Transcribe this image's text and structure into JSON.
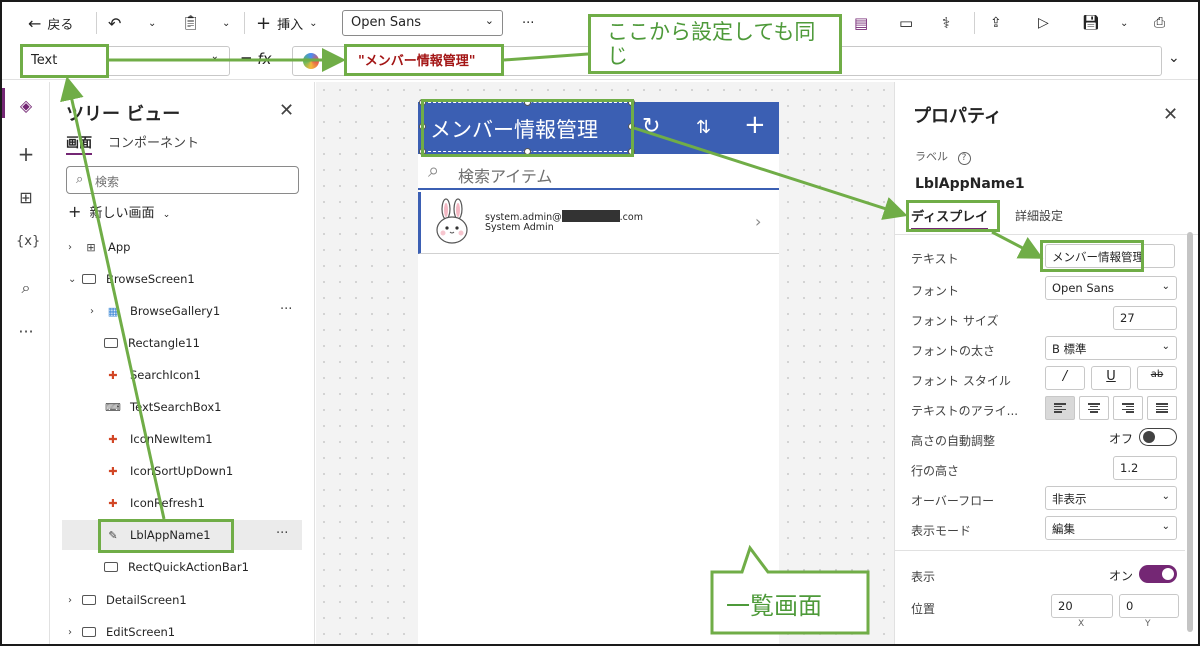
{
  "toolbar": {
    "back_label": "戻る",
    "insert_label": "挿入",
    "font_value": "Open Sans",
    "more": "···"
  },
  "formula": {
    "property": "Text",
    "fx": "= fx",
    "value": "\"メンバー情報管理\""
  },
  "tree": {
    "title": "ツリー ビュー",
    "tabs": [
      "画面",
      "コンポーネント"
    ],
    "search_placeholder": "検索",
    "new_screen": "新しい画面",
    "nodes": [
      {
        "label": "App"
      },
      {
        "label": "BrowseScreen1"
      },
      {
        "label": "BrowseGallery1"
      },
      {
        "label": "Rectangle11"
      },
      {
        "label": "SearchIcon1"
      },
      {
        "label": "TextSearchBox1"
      },
      {
        "label": "IconNewItem1"
      },
      {
        "label": "IconSortUpDown1"
      },
      {
        "label": "IconRefresh1"
      },
      {
        "label": "LblAppName1"
      },
      {
        "label": "RectQuickActionBar1"
      },
      {
        "label": "DetailScreen1"
      },
      {
        "label": "EditScreen1"
      }
    ]
  },
  "canvas": {
    "app_title": "メンバー情報管理",
    "search_placeholder": "検索アイテム",
    "item_email_prefix": "system.admin@",
    "item_email_suffix": ".com",
    "item_name": "System Admin"
  },
  "props": {
    "title": "プロパティ",
    "label_type": "ラベル",
    "control_name": "LblAppName1",
    "tabs": [
      "ディスプレイ",
      "詳細設定"
    ],
    "rows": {
      "text": {
        "label": "テキスト",
        "value": "メンバー情報管理"
      },
      "font": {
        "label": "フォント",
        "value": "Open Sans"
      },
      "font_size": {
        "label": "フォント サイズ",
        "value": "27"
      },
      "font_weight": {
        "label": "フォントの太さ",
        "value": "B  標準"
      },
      "font_style": {
        "label": "フォント スタイル",
        "italic": "/",
        "underline": "U",
        "strike": "ab"
      },
      "text_align": {
        "label": "テキストのアライ..."
      },
      "auto_height": {
        "label": "高さの自動調整",
        "value": "オフ"
      },
      "line_height": {
        "label": "行の高さ",
        "value": "1.2"
      },
      "overflow": {
        "label": "オーバーフロー",
        "value": "非表示"
      },
      "display_mode": {
        "label": "表示モード",
        "value": "編集"
      },
      "visible": {
        "label": "表示",
        "value": "オン"
      },
      "position": {
        "label": "位置",
        "x": "20",
        "y": "0",
        "x_caption": "X",
        "y_caption": "Y"
      }
    }
  },
  "annotations": {
    "formula_note": "ここから設定しても同じ",
    "screen_note": "一覧画面"
  },
  "colors": {
    "accent": "#742774",
    "header": "#3b5fb3",
    "annotation": "#70ad47"
  }
}
